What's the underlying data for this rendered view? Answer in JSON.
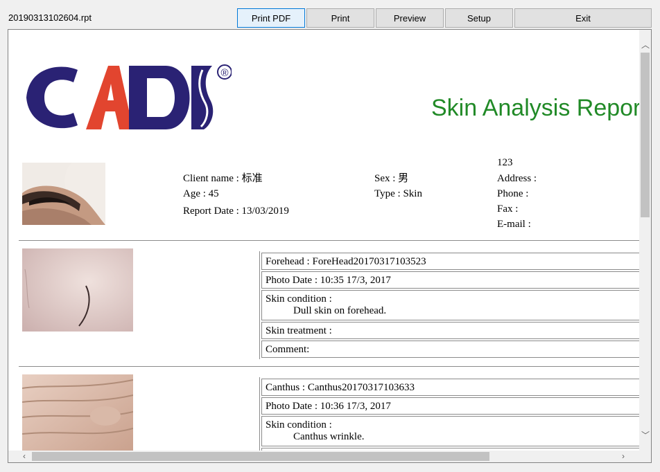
{
  "window": {
    "filename": "20190313102604.rpt",
    "toolbar": {
      "print_pdf": "Print PDF",
      "print": "Print",
      "preview": "Preview",
      "setup": "Setup",
      "exit": "Exit"
    }
  },
  "report": {
    "logo_text": "CADI",
    "logo_mark": "®",
    "title": "Skin Analysis Report",
    "client": {
      "name": "Client name : 标准",
      "age": "Age : 45",
      "report_date": "Report Date : 13/03/2019",
      "sex": "Sex : 男",
      "type": "Type : Skin",
      "id": "123",
      "address": "Address :",
      "phone": "Phone :",
      "fax": "Fax :",
      "email": "E-mail :"
    },
    "sections": [
      {
        "area": "Forehead : ForeHead20170317103523",
        "photo_date": "Photo Date : 10:35 17/3, 2017",
        "skin_condition_label": "Skin condition :",
        "skin_condition_value": "Dull skin on forehead.",
        "skin_treatment_label": "Skin treatment :",
        "comment_label": "Comment:"
      },
      {
        "area": "Canthus : Canthus20170317103633",
        "photo_date": "Photo Date : 10:36 17/3, 2017",
        "skin_condition_label": "Skin condition :",
        "skin_condition_value": "Canthus wrinkle."
      }
    ]
  },
  "colors": {
    "logo_blue": "#2a2274",
    "logo_red": "#e2452f",
    "title_green": "#218a27"
  }
}
